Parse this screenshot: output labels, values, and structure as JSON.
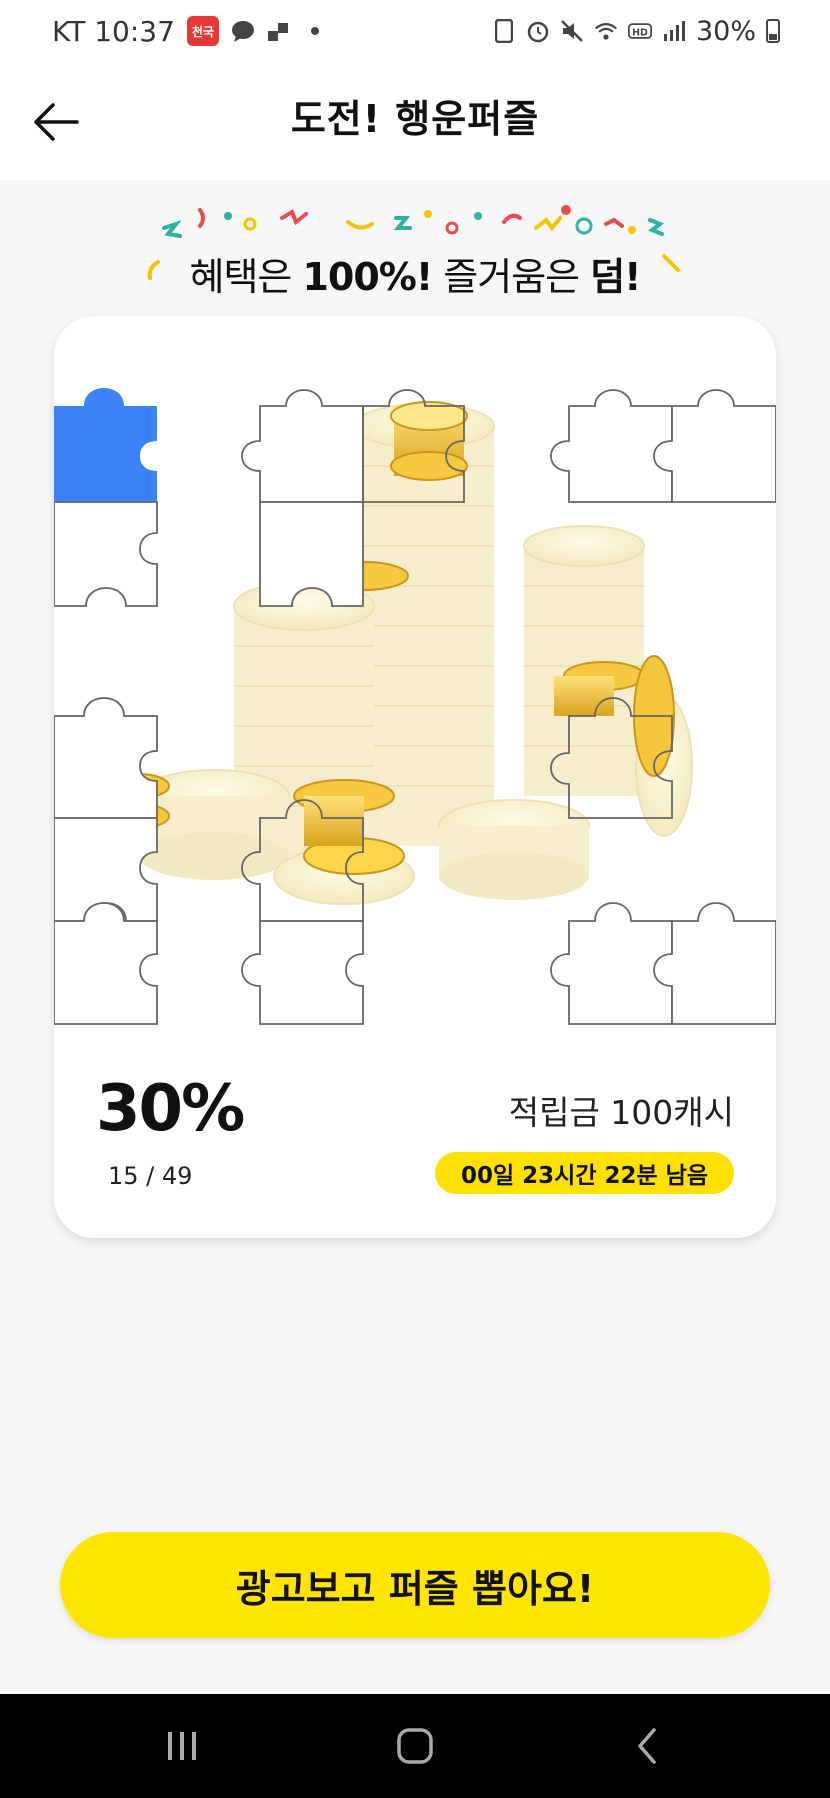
{
  "status_bar": {
    "carrier_time": "KT 10:37",
    "app_badge": "천국",
    "battery": "30%"
  },
  "header": {
    "title": "도전! 행운퍼즐",
    "back_icon": "arrow-left-icon"
  },
  "banner": {
    "text_1": "혜택은 ",
    "text_2": "100%!",
    "text_3": " 즐거움은 ",
    "text_4": "덤!"
  },
  "puzzle": {
    "progress_percent": "30%",
    "collected_count": "15 / 49",
    "reward": "적립금 100캐시",
    "time_left": "00일 23시간 22분 남음",
    "collected": 15,
    "total": 49,
    "highlight_color": "#3b82f6"
  },
  "cta": {
    "label": "광고보고 퍼즐 뽑아요!",
    "color": "#ffe600"
  },
  "nav": {
    "recent_icon": "recent-apps-icon",
    "home_icon": "home-icon",
    "back_icon": "back-icon"
  }
}
